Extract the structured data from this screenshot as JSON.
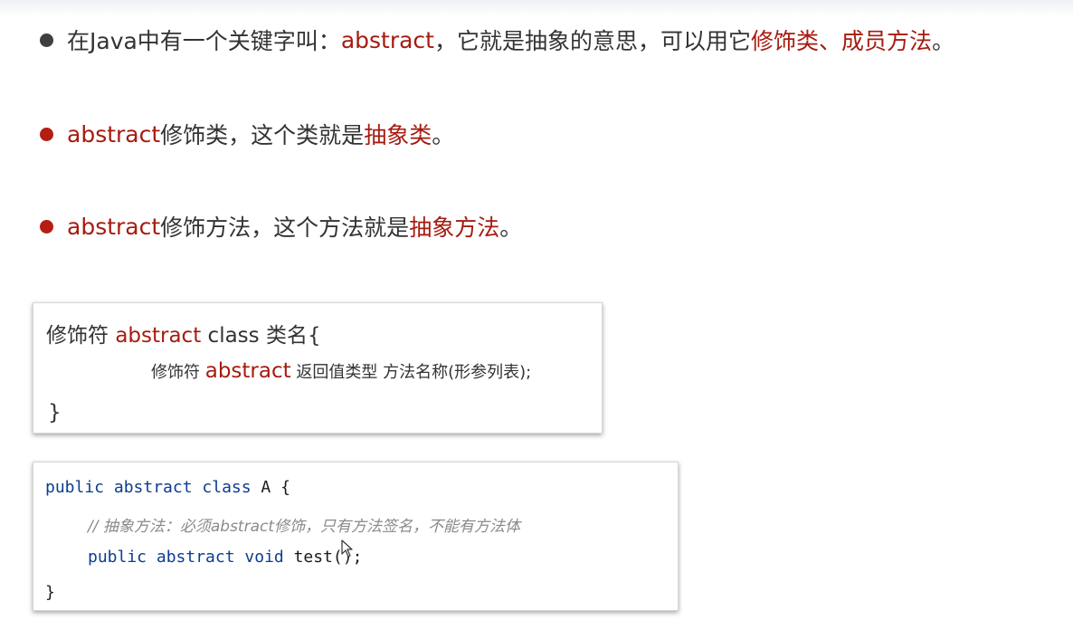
{
  "bullets": [
    {
      "segments": [
        {
          "text": "在Java中有一个关键字叫：",
          "hl": false
        },
        {
          "text": "abstract",
          "hl": true
        },
        {
          "text": "，它就是抽象的意思，可以用它",
          "hl": false
        },
        {
          "text": "修饰类、成员方法",
          "hl": true
        },
        {
          "text": "。",
          "hl": false
        }
      ]
    },
    {
      "segments": [
        {
          "text": "abstract",
          "hl": true
        },
        {
          "text": "修饰类，这个类就是",
          "hl": false
        },
        {
          "text": "抽象类",
          "hl": true
        },
        {
          "text": "。",
          "hl": false
        }
      ]
    },
    {
      "segments": [
        {
          "text": "abstract",
          "hl": true
        },
        {
          "text": "修饰方法，这个方法就是",
          "hl": false
        },
        {
          "text": "抽象方法",
          "hl": true
        },
        {
          "text": "。",
          "hl": false
        }
      ]
    }
  ],
  "syntax": {
    "line1_prefix": "修饰符 ",
    "line1_keyword": "abstract",
    "line1_suffix": " class 类名{",
    "line2_prefix": "修饰符 ",
    "line2_keyword": "abstract",
    "line2_suffix": " 返回值类型 方法名称(形参列表);",
    "line3": "}"
  },
  "code": {
    "line1_kw": "public abstract class",
    "line1_rest": " A {",
    "line2_comment": "// 抽象方法：必须abstract修饰，只有方法签名，不能有方法体",
    "line3_kw": "public abstract void",
    "line3_rest": " test();",
    "line4": "}"
  },
  "colors": {
    "highlight": "#a61b10",
    "bullet_gray": "#3f3f3f",
    "bullet_red": "#b41e12",
    "code_keyword": "#0b3d91",
    "code_comment": "#8a8a8a"
  },
  "icons": [
    "mouse-pointer-icon"
  ]
}
